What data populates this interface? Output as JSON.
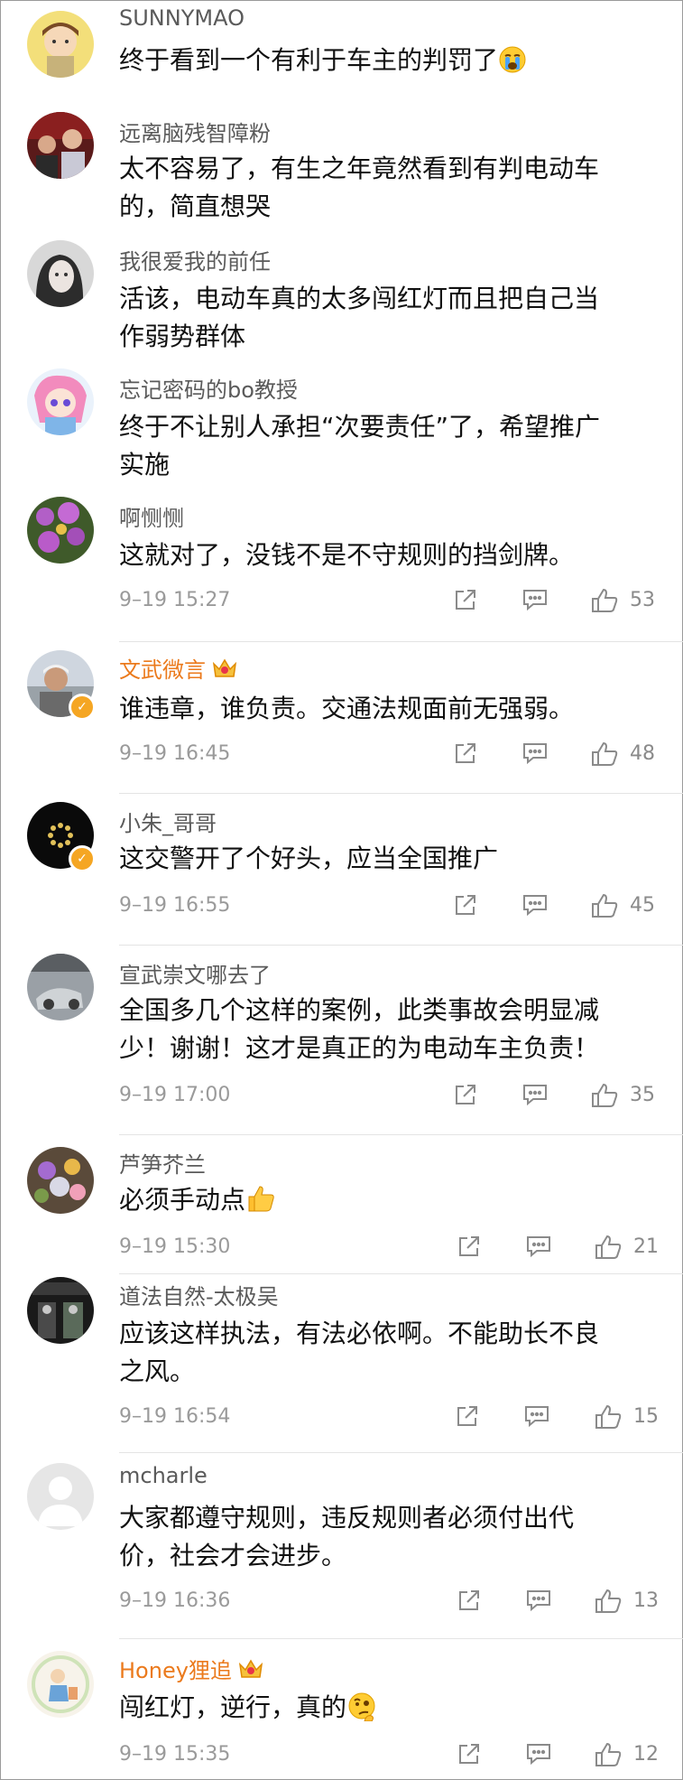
{
  "comments": [
    {
      "user": "SUNNYMAO",
      "text": "终于看到一个有利于车主的判罚了"
    },
    {
      "user": "远离脑残智障粉",
      "text_lines": [
        "太不容易了，有生之年竟然看到有判电动车",
        "的，简直想哭"
      ]
    },
    {
      "user": "我很爱我的前任",
      "text_lines": [
        "活该，电动车真的太多闯红灯而且把自己当",
        "作弱势群体"
      ]
    },
    {
      "user": "忘记密码的bo教授",
      "text_lines": [
        "终于不让别人承担“次要责任”了，希望推广",
        "实施"
      ]
    },
    {
      "user": "啊恻恻",
      "text": "这就对了，没钱不是不守规则的挡剑牌。",
      "time": "9–19 15:27",
      "likes": "53"
    },
    {
      "user": "文武微言",
      "text": "谁违章，谁负责。交通法规面前无强弱。",
      "time": "9–19 16:45",
      "likes": "48"
    },
    {
      "user": "小朱_哥哥",
      "text": "这交警开了个好头，应当全国推广",
      "time": "9–19 16:55",
      "likes": "45"
    },
    {
      "user": "宣武崇文哪去了",
      "text_lines": [
        "全国多几个这样的案例，此类事故会明显减",
        "少！谢谢！这才是真正的为电动车主负责！"
      ],
      "time": "9–19 17:00",
      "likes": "35"
    },
    {
      "user": "芦笋芥兰",
      "text": "必须手动点",
      "time": "9–19 15:30",
      "likes": "21"
    },
    {
      "user": "道法自然-太极吴",
      "text_lines": [
        "应该这样执法，有法必依啊。不能助长不良",
        "之风。"
      ],
      "time": "9–19 16:54",
      "likes": "15"
    },
    {
      "user": "mcharle",
      "text_lines": [
        "大家都遵守规则，违反规则者必须付出代",
        "价，社会才会进步。"
      ],
      "time": "9–19 16:36",
      "likes": "13"
    },
    {
      "user": "Honey狸追",
      "text": "闯红灯，逆行，真的",
      "time": "9–19 15:35",
      "likes": "12"
    }
  ],
  "icons": {
    "share": "share-icon",
    "comment": "comment-icon",
    "like": "thumbs-up-icon",
    "vip": "crown-icon",
    "verified": "verified-badge-icon"
  },
  "colors": {
    "vip_name": "#eb7a1c",
    "username": "#5a5a5a",
    "meta": "#9a9a9a",
    "verified": "#f5a623"
  }
}
